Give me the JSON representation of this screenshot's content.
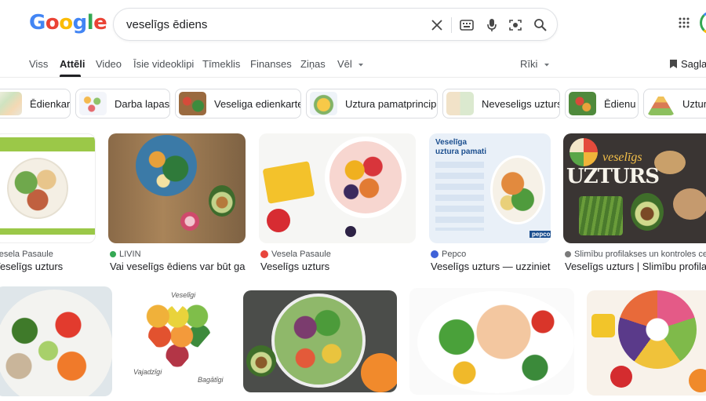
{
  "search": {
    "query": "veselīgs ēdiens"
  },
  "logo": {
    "letters": [
      "G",
      "o",
      "o",
      "g",
      "l",
      "e"
    ]
  },
  "tabs": [
    {
      "label": "Viss"
    },
    {
      "label": "Attēli"
    },
    {
      "label": "Video"
    },
    {
      "label": "Īsie videoklipi"
    },
    {
      "label": "Tīmeklis"
    },
    {
      "label": "Finanses"
    },
    {
      "label": "Ziņas"
    },
    {
      "label": "Vēl"
    }
  ],
  "tools": {
    "label": "Rīki",
    "saved_label": "Saglab"
  },
  "chips": [
    {
      "label": "Ēdienkarte"
    },
    {
      "label": "Darba lapas"
    },
    {
      "label": "Veseliga edienkarte"
    },
    {
      "label": "Uztura pamatprincipi"
    },
    {
      "label": "Neveseligs uzturs"
    },
    {
      "label": "Ēdienu"
    },
    {
      "label": "Uztura"
    }
  ],
  "results_row1": [
    {
      "source": "Vesela Pasaule",
      "title": "Veselīgs uzturs"
    },
    {
      "source": "LIVIN",
      "title": "Vai veselīgs ēdiens var būt gar..."
    },
    {
      "source": "Vesela Pasaule",
      "title": "Veselīgs uzturs"
    },
    {
      "source": "Pepco",
      "title": "Veselīgs uzturs — uzziniet ..."
    },
    {
      "source": "Slimību profilakses un kontroles centrs",
      "title": "Veselīgs uzturs | Slimību profilakses"
    }
  ],
  "image_text": {
    "pepco_heading": "Veselīga uztura pamati",
    "pepco_brand": "pepco",
    "uzturs_big": "UZTURS",
    "uzturs_small": "veselīgs",
    "heart_top": "Veselīgi",
    "heart_left": "Vajadzīgi",
    "heart_right": "Bagātīgi"
  },
  "colors": {
    "google_blue": "#4285f4",
    "google_red": "#ea4335",
    "google_yellow": "#fbbc05",
    "google_green": "#34a853"
  }
}
